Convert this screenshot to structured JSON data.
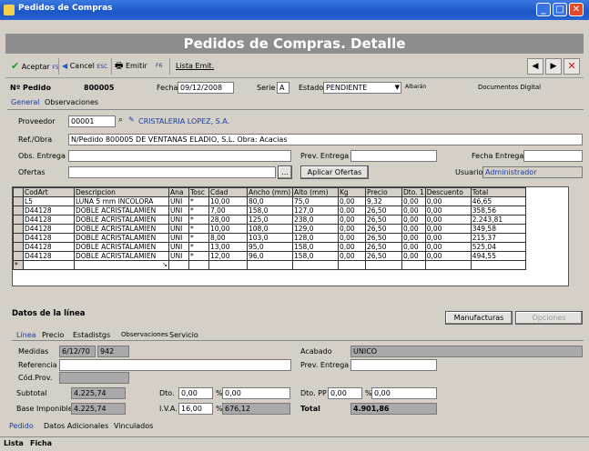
{
  "window": {
    "title": "Pedidos de Compras"
  },
  "header": {
    "title": "Pedidos de Compras. Detalle"
  },
  "toolbar": {
    "accept_label": "Aceptar",
    "accept_key": "F5",
    "cancel_label": "Cancel",
    "cancel_key": "ESC",
    "print_label": "Emitir",
    "print_key": "F6",
    "list_label": "Lista Emit."
  },
  "order": {
    "num_label": "Nº Pedido",
    "num_value": "800005",
    "date_label": "Fecha",
    "date_value": "09/12/2008",
    "serie_label": "Serie",
    "serie_value": "A",
    "estado_label": "Estado",
    "estado_value": "PENDIENTE",
    "albaran_label": "Albarán",
    "docs_label": "Documentos Digital"
  },
  "tabs_top": [
    "General",
    "Observaciones"
  ],
  "form": {
    "proveedor_label": "Proveedor",
    "proveedor_code": "00001",
    "proveedor_name": "CRISTALERIA LOPEZ, S.A.",
    "ref_label": "Ref./Obra",
    "ref_value": "N/Pedido 800005 DE VENTANAS ELADIO, S.L. Obra: Acacias",
    "obs_label": "Obs. Entrega",
    "prev_label": "Prev. Entrega",
    "fecha_entrega_label": "Fecha Entrega",
    "ofertas_label": "Ofertas",
    "ofertas_btn": "...",
    "aplicar_btn": "Aplicar Ofertas",
    "usuario_label": "Usuario",
    "usuario_value": "Administrador"
  },
  "grid": {
    "columns": [
      "CodArt",
      "Descripcion",
      "Ana",
      "Tosc",
      "Cdad",
      "Ancho (mm)",
      "Alto (mm)",
      "Kg",
      "Precio",
      "Dto. 1",
      "Descuento",
      "Total"
    ],
    "rows": [
      [
        "L5",
        "LUNA 5 mm INCOLORA",
        "UNI",
        "*",
        "10,00",
        "80,0",
        "75,0",
        "0,00",
        "9,32",
        "0,00",
        "0,00",
        "46,65"
      ],
      [
        "D44128",
        "DOBLE ACRISTALAMIEN",
        "UNI",
        "*",
        "7,00",
        "158,0",
        "127,0",
        "0,00",
        "26,50",
        "0,00",
        "0,00",
        "358,56"
      ],
      [
        "D44128",
        "DOBLE ACRISTALAMIEN",
        "UNI",
        "*",
        "28,00",
        "125,0",
        "238,0",
        "0,00",
        "26,50",
        "0,00",
        "0,00",
        "2.243,81"
      ],
      [
        "D44128",
        "DOBLE ACRISTALAMIEN",
        "UNI",
        "*",
        "10,00",
        "108,0",
        "129,0",
        "0,00",
        "26,50",
        "0,00",
        "0,00",
        "349,58"
      ],
      [
        "D44128",
        "DOBLE ACRISTALAMIEN",
        "UNI",
        "*",
        "8,00",
        "103,0",
        "128,0",
        "0,00",
        "26,50",
        "0,00",
        "0,00",
        "215,37"
      ],
      [
        "D44128",
        "DOBLE ACRISTALAMIEN",
        "UNI",
        "*",
        "13,00",
        "95,0",
        "158,0",
        "0,00",
        "26,50",
        "0,00",
        "0,00",
        "525,04"
      ],
      [
        "D44128",
        "DOBLE ACRISTALAMIEN",
        "UNI",
        "*",
        "12,00",
        "96,0",
        "158,0",
        "0,00",
        "26,50",
        "0,00",
        "0,00",
        "494,55"
      ]
    ]
  },
  "detail": {
    "title": "Datos de la línea",
    "manufacture_btn": "Manufacturas",
    "opciones_btn": "Opciones",
    "tabs": [
      "Línea",
      "Precio",
      "Estadistgs",
      "Observaciones",
      "Servicio"
    ],
    "medidas_label": "Medidas",
    "medidas_a": "6/12/70",
    "medidas_b": "942",
    "referencia_label": "Referencia",
    "codprov_label": "Cód.Prov.",
    "acabado_label": "Acabado",
    "acabado_value": "UNICO",
    "prev_entrega_label": "Prev. Entrega"
  },
  "totals": {
    "subtotal_label": "Subtotal",
    "subtotal_value": "4.225,74",
    "dto_label": "Dto.",
    "dto_a": "0,00",
    "dto_pct": "%",
    "dto_b": "0,00",
    "dtopp_label": "Dto. PP",
    "dtopp_a": "0,00",
    "dtopp_pct": "%",
    "dtopp_b": "0,00",
    "base_label": "Base Imponible",
    "base_value": "4.225,74",
    "iva_label": "I.V.A.",
    "iva_a": "16,00",
    "iva_pct": "%",
    "iva_b": "676,12",
    "total_label": "Total",
    "total_value": "4.901,86"
  },
  "tabs_bottom": [
    "Pedido",
    "Datos Adicionales",
    "Vinculados"
  ],
  "status_tabs": [
    "Lista",
    "Ficha"
  ]
}
